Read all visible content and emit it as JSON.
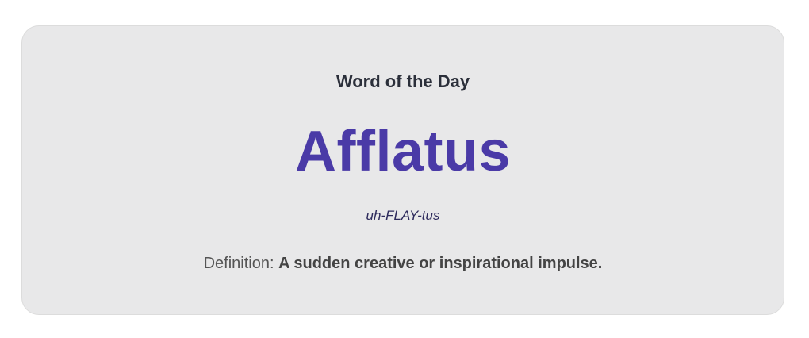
{
  "word_of_the_day": {
    "heading": "Word of the Day",
    "word": "Afflatus",
    "pronunciation": "uh-FLAY-tus",
    "definition_label": "Definition: ",
    "definition_text": "A sudden creative or inspirational impulse."
  },
  "colors": {
    "card_background": "#e8e8e9",
    "word": "#4a3aa7",
    "heading": "#2b2f3a",
    "pronunciation": "#2d2a5c",
    "definition": "#555555"
  }
}
